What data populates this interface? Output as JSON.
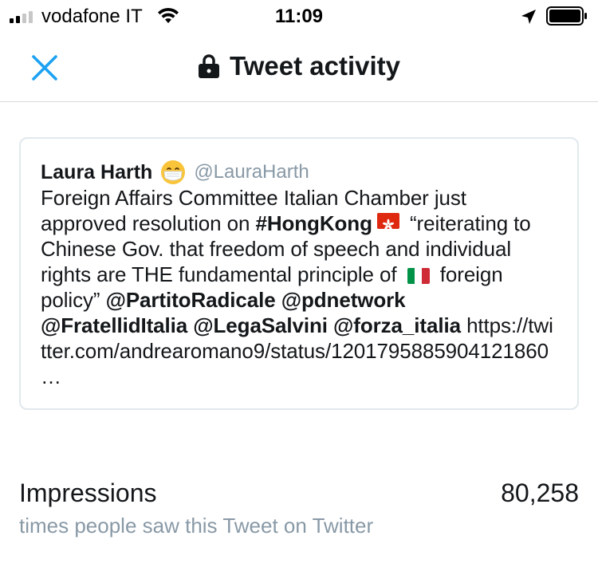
{
  "status_bar": {
    "carrier": "vodafone IT",
    "time": "11:09"
  },
  "header": {
    "title": "Tweet activity",
    "close_icon": "close-icon",
    "lock_icon": "lock-icon"
  },
  "tweet": {
    "author_name": "Laura Harth",
    "handle": "@LauraHarth",
    "segments": [
      "Foreign Affairs Committee Italian Chamber just approved resolution on ",
      "#HongKong",
      " “reiterating to Chinese Gov. that freedom of speech and individual rights are THE fundamental principle of ",
      " foreign policy” ",
      "@PartitoRadicale",
      "@pdnetwork",
      "@FratellidItalia",
      "@LegaSalvini",
      "@forza_italia",
      "https://twitter.com/andrearomano9/status/1201795885904121860 …"
    ]
  },
  "metrics": {
    "impressions_label": "Impressions",
    "impressions_value": "80,258",
    "impressions_description": "times people saw this Tweet on Twitter"
  },
  "colors": {
    "accent": "#1da1f2",
    "muted": "#8899a6",
    "border": "#e1e8ed",
    "text": "#14171a"
  }
}
